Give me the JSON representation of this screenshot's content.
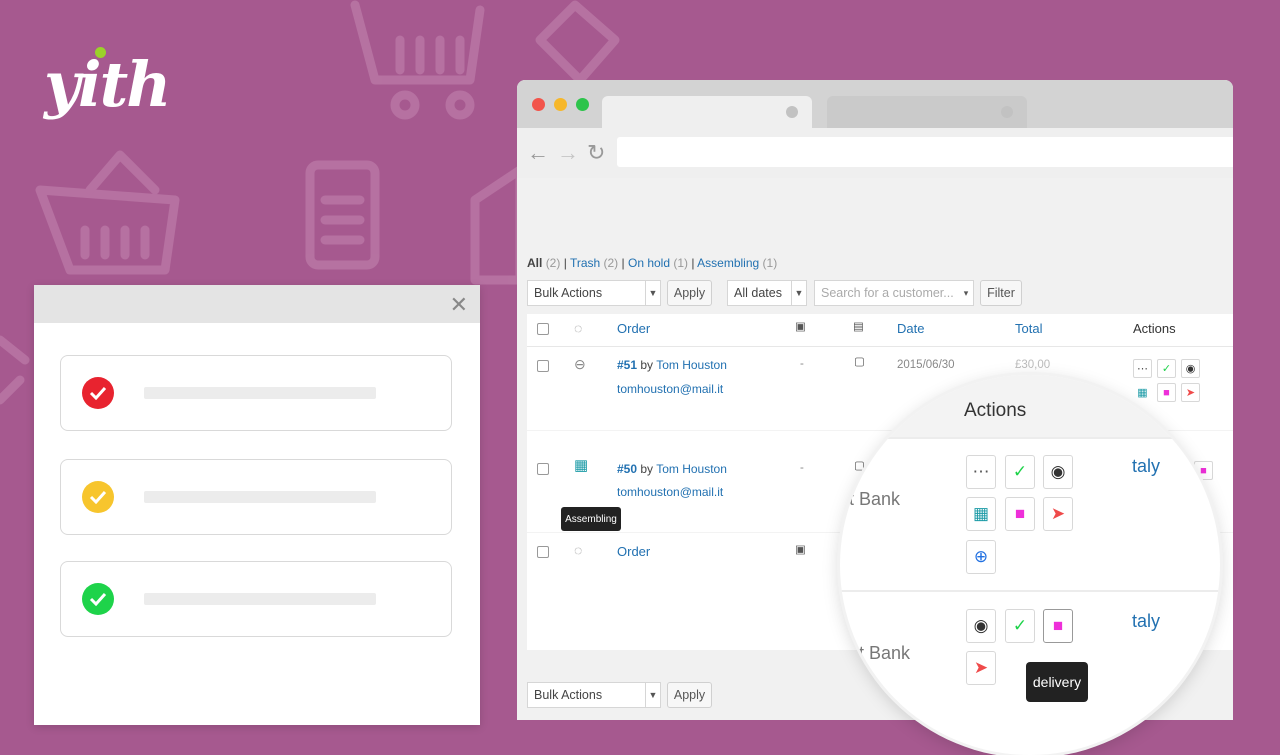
{
  "brand": {
    "logo_text": "yith"
  },
  "dialog": {
    "close_icon": "close-icon",
    "items": [
      {
        "status": "error",
        "color": "#e8232f"
      },
      {
        "status": "warning",
        "color": "#f7c52d"
      },
      {
        "status": "success",
        "color": "#1ed34a"
      }
    ]
  },
  "filters": {
    "all": "All",
    "all_count": "(2)",
    "trash": "Trash",
    "trash_count": "(2)",
    "on_hold": "On hold",
    "on_hold_count": "(1)",
    "assembling": "Assembling",
    "assembling_count": "(1)"
  },
  "toolbar": {
    "bulk_actions": "Bulk Actions",
    "apply": "Apply",
    "all_dates": "All dates",
    "search_placeholder": "Search for a customer...",
    "filter": "Filter"
  },
  "table": {
    "headers": {
      "order": "Order",
      "date": "Date",
      "total": "Total",
      "actions": "Actions"
    },
    "rows": [
      {
        "order_number": "#51",
        "by": "by",
        "customer": "Tom Houston",
        "email": "tomhouston@mail.it",
        "dash": "-",
        "date": "2015/06/30",
        "total": "£30,00"
      },
      {
        "order_number": "#50",
        "by": "by",
        "customer": "Tom Houston",
        "email": "tomhouston@mail.it",
        "dash": "-",
        "status_tooltip": "Assembling"
      }
    ],
    "footer_order": "Order"
  },
  "magnifier": {
    "header": "Actions",
    "row1_payment": "ct Bank",
    "row1_country": "taly",
    "row2_payment": "ect Bank",
    "row2_country": "taly",
    "tooltip": "delivery"
  }
}
